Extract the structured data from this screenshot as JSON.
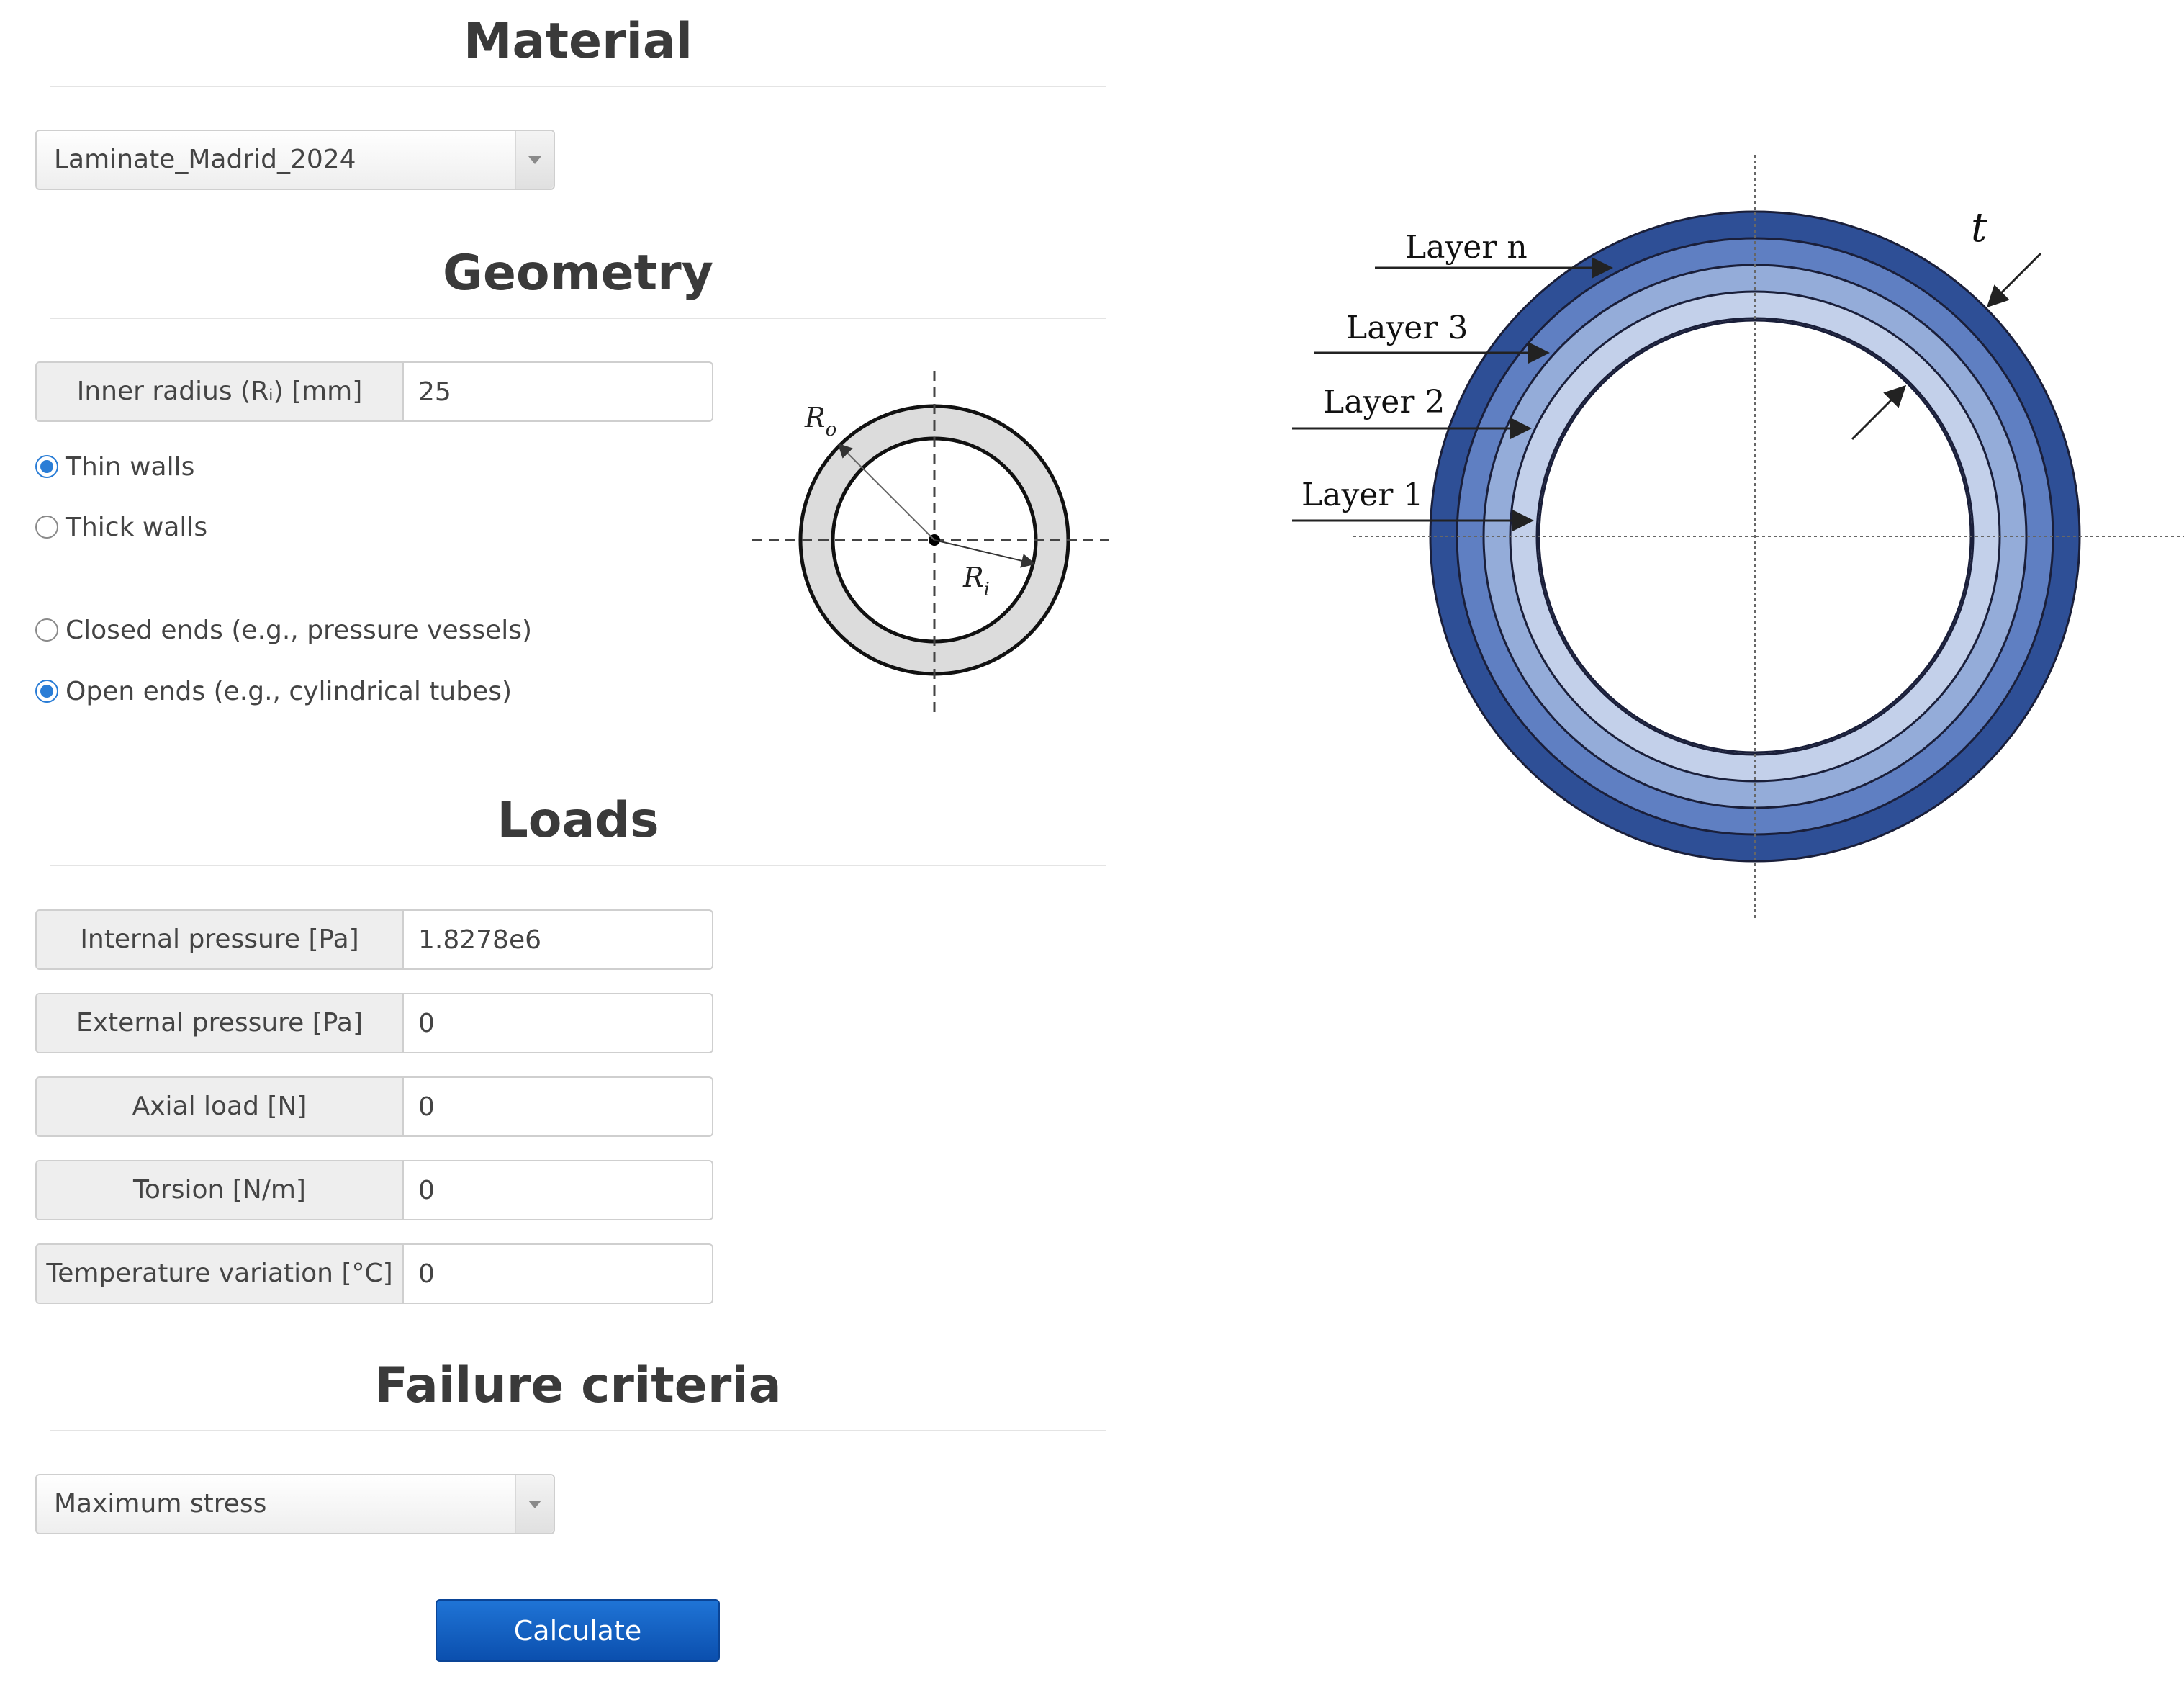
{
  "material": {
    "title": "Material",
    "selected": "Laminate_Madrid_2024"
  },
  "geometry": {
    "title": "Geometry",
    "inner_radius_label": "Inner radius (Rᵢ) [mm]",
    "inner_radius_value": "25",
    "thin_walls": "Thin walls",
    "thick_walls": "Thick walls",
    "closed_ends": "Closed ends (e.g., pressure vessels)",
    "open_ends": "Open ends (e.g., cylindrical tubes)",
    "wall_selected": "thin",
    "ends_selected": "open",
    "diagram": {
      "ro": "R",
      "ro_sub": "o",
      "ri": "R",
      "ri_sub": "i"
    }
  },
  "loads": {
    "title": "Loads",
    "fields": [
      {
        "label": "Internal pressure [Pa]",
        "value": "1.8278e6"
      },
      {
        "label": "External pressure [Pa]",
        "value": "0"
      },
      {
        "label": "Axial load [N]",
        "value": "0"
      },
      {
        "label": "Torsion [N/m]",
        "value": "0"
      },
      {
        "label": "Temperature variation [°C]",
        "value": "0"
      }
    ]
  },
  "failure": {
    "title": "Failure criteria",
    "selected": "Maximum stress"
  },
  "calculate_label": "Calculate",
  "layers_diagram": {
    "layer_n": "Layer n",
    "layer_3": "Layer 3",
    "layer_2": "Layer 2",
    "layer_1": "Layer 1",
    "thickness": "t",
    "colors": [
      "#2e4f96",
      "#5f7fc2",
      "#94acd9",
      "#c3d0ea",
      "#e1e7f4"
    ]
  }
}
